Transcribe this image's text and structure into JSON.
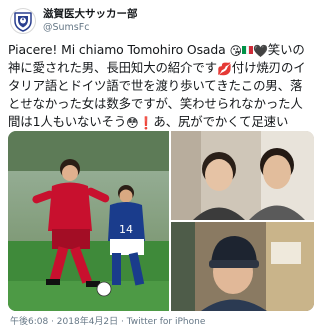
{
  "tweet": {
    "display_name": "滋賀医大サッカー部",
    "handle": "@SumsFc",
    "text_part1": "Piacere! Mi chiamo Tomohiro Osada ",
    "text_part2": "笑いの神に愛された男、長田知大の紹介です",
    "text_part3": "付け焼刃のイタリア語とドイツ語で世を渡り歩いてきたこの男、落とせなかった女は数多ですが、笑わせられなかった人間は1人もいないそう",
    "text_part4": "あ、尻がでかくて足速いよ！",
    "emojis": {
      "kiss": "😘",
      "heart_black": "🖤",
      "lips": "💋",
      "flushed": "😳",
      "exclamation": "❗",
      "peach": "🍑"
    },
    "timestamp": "午後6:08 · 2018年4月2日 · Twitter for iPhone",
    "jersey_number": "14"
  },
  "colors": {
    "flag_green": "#009246",
    "flag_white": "#ffffff",
    "flag_red": "#ce2b37",
    "jersey_red": "#c8102e",
    "jersey_blue": "#1a3c8c",
    "grass": "#3f8a3a"
  }
}
